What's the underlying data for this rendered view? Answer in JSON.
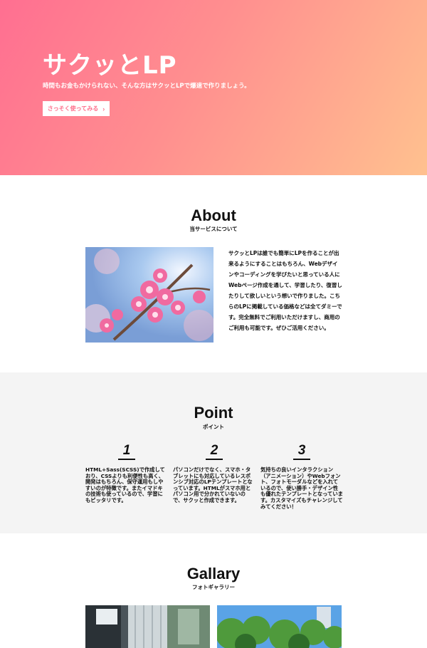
{
  "hero": {
    "title": "サクッとLP",
    "subtitle": "時間もお金もかけられない、そんな方はサクッとLPで爆速で作りましょう。",
    "cta_label": "さっそく使ってみる",
    "cta_icon": "chevron-right-icon",
    "gradient_colors": [
      "#ff6f91",
      "#ffc18f"
    ]
  },
  "about": {
    "title": "About",
    "subtitle": "当サービスについて",
    "image": "cherry-blossom-photo",
    "body": "サクッとLPは誰でも簡単にLPを作ることが出来るようにすることはもちろん、Webデザインやコーディングを学びたいと思っている人にWebページ作成を通して、学習したり、復習したりして欲しいという想いで作りました。こちらのLPに掲載している価格などは全てダミーです。完全無料でご利用いただけますし、商用のご利用も可能です。ぜひご活用ください。"
  },
  "point": {
    "title": "Point",
    "subtitle": "ポイント",
    "background": "#f4f4f4",
    "items": [
      {
        "number": "1",
        "text": "HTML+Sass(SCSS)で作成しており、CSSよりも利便性も高く、開発はもちろん、保守運用もしやすいのが特徴です。またイマドキの技術も使っているので、学習にもピッタリです。"
      },
      {
        "number": "2",
        "text": "パソコンだけでなく、スマホ・タブレットにも対応しているレスポンシブ対応のLPテンプレートとなっています。HTMLがスマホ用とパソコン用で分かれていないので、サクッと作成できます。"
      },
      {
        "number": "3",
        "text": "気持ちの良いインタラクション（アニメーション）やWebフォント、フォトモーダルなどを入れているので、使い勝手・デザイン性も優れたテンプレートとなっています。カスタマイズもチャレンジしてみてください！"
      }
    ]
  },
  "gallery": {
    "title": "Gallary",
    "subtitle": "フォトギャラリー",
    "images": [
      "street-building-photo",
      "green-trees-photo"
    ]
  }
}
